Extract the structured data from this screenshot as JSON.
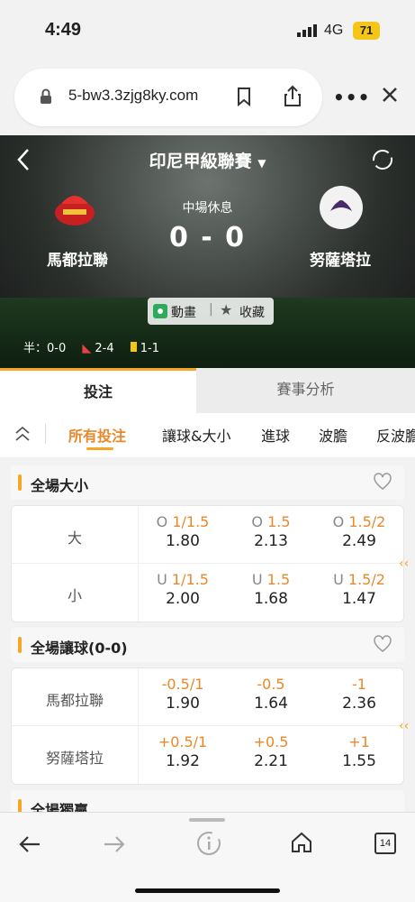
{
  "status_bar": {
    "time": "4:49",
    "network": "4G",
    "battery": "71"
  },
  "browser": {
    "url": "5-bw3.3zjg8ky.com",
    "tab_count": "14"
  },
  "match": {
    "league": "印尼甲級聯賽",
    "status": "中場休息",
    "score": "0 - 0",
    "home_team": "馬都拉聯",
    "away_team": "努薩塔拉",
    "animation_label": "動畫",
    "favorite_label": "收藏",
    "half_score": "半：0-0",
    "corners": "2-4",
    "cards": "1-1"
  },
  "tabs": {
    "betting": "投注",
    "analysis": "賽事分析"
  },
  "filters": [
    "所有投注",
    "讓球&大小",
    "進球",
    "波膽",
    "反波膽"
  ],
  "over_under": {
    "title": "全場大小",
    "rows": [
      {
        "label": "大",
        "cells": [
          {
            "prefix": "O",
            "line": "1/1.5",
            "odds": "1.80"
          },
          {
            "prefix": "O",
            "line": "1.5",
            "odds": "2.13"
          },
          {
            "prefix": "O",
            "line": "1.5/2",
            "odds": "2.49"
          }
        ]
      },
      {
        "label": "小",
        "cells": [
          {
            "prefix": "U",
            "line": "1/1.5",
            "odds": "2.00"
          },
          {
            "prefix": "U",
            "line": "1.5",
            "odds": "1.68"
          },
          {
            "prefix": "U",
            "line": "1.5/2",
            "odds": "1.47"
          }
        ]
      }
    ]
  },
  "handicap": {
    "title": "全場讓球(0-0)",
    "rows": [
      {
        "label": "馬都拉聯",
        "cells": [
          {
            "prefix": "",
            "line": "-0.5/1",
            "odds": "1.90"
          },
          {
            "prefix": "",
            "line": "-0.5",
            "odds": "1.64"
          },
          {
            "prefix": "",
            "line": "-1",
            "odds": "2.36"
          }
        ]
      },
      {
        "label": "努薩塔拉",
        "cells": [
          {
            "prefix": "",
            "line": "+0.5/1",
            "odds": "1.92"
          },
          {
            "prefix": "",
            "line": "+0.5",
            "odds": "2.21"
          },
          {
            "prefix": "",
            "line": "+1",
            "odds": "1.55"
          }
        ]
      }
    ]
  },
  "next_section": {
    "title": "全場獨贏"
  },
  "colors": {
    "accent": "#f5a623",
    "odds_line": "#e8882b"
  }
}
